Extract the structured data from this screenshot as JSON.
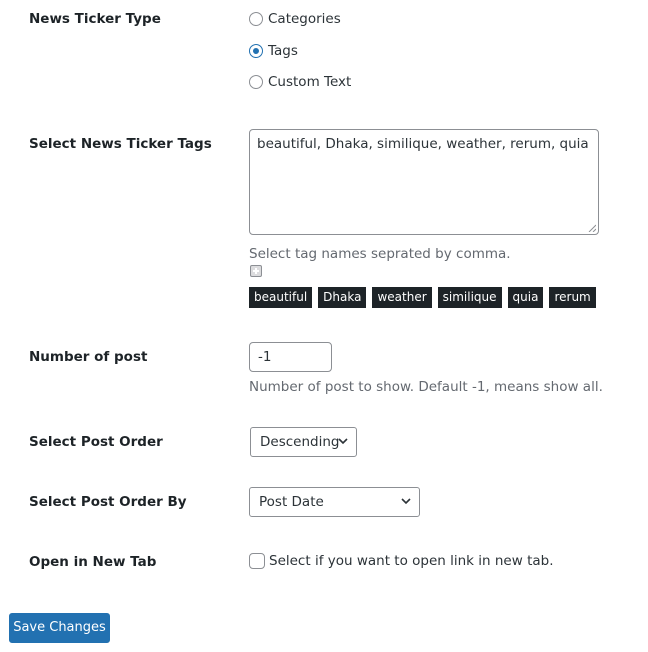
{
  "ticker_type": {
    "label": "News Ticker Type",
    "options": [
      "Categories",
      "Tags",
      "Custom Text"
    ],
    "selected": "Tags"
  },
  "ticker_tags": {
    "label": "Select News Ticker Tags",
    "value": "beautiful, Dhaka, similique, weather, rerum, quia",
    "description": "Select tag names seprated by comma.",
    "add_icon": "plus-box-icon",
    "tags": [
      "beautiful",
      "Dhaka",
      "weather",
      "similique",
      "quia",
      "rerum"
    ]
  },
  "number_of_post": {
    "label": "Number of post",
    "value": "-1",
    "description": "Number of post to show. Default -1, means show all."
  },
  "post_order": {
    "label": "Select Post Order",
    "value": "Descending"
  },
  "post_order_by": {
    "label": "Select Post Order By",
    "value": "Post Date"
  },
  "new_tab": {
    "label": "Open in New Tab",
    "checkbox_label": "Select if you want to open link in new tab.",
    "checked": false
  },
  "save_label": "Save Changes",
  "colors": {
    "primary": "#2271b1",
    "tag_bg": "#1d2327",
    "label_text": "#1d2327",
    "description_text": "#646970"
  }
}
